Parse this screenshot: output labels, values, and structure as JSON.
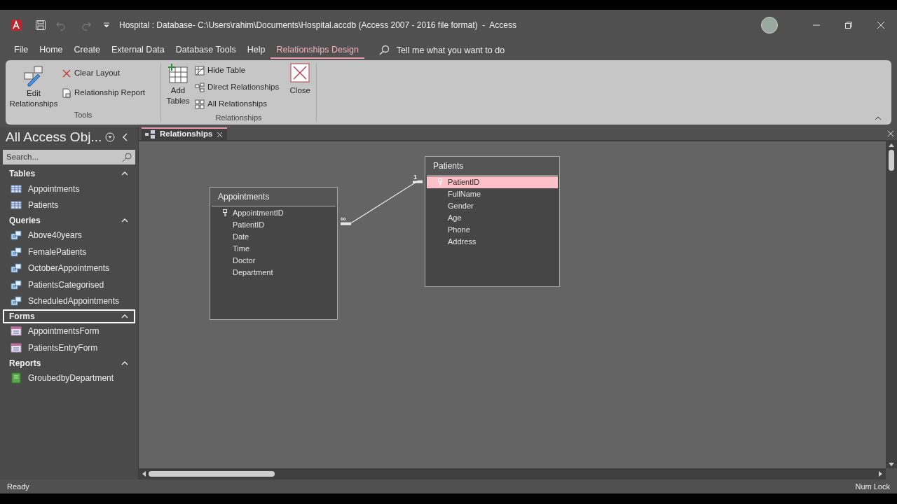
{
  "window": {
    "title": "Hospital : Database- C:\\Users\\rahim\\Documents\\Hospital.accdb (Access 2007 - 2016 file format)  -  Access"
  },
  "menu_tabs": [
    {
      "label": "File",
      "selected": false
    },
    {
      "label": "Home",
      "selected": false
    },
    {
      "label": "Create",
      "selected": false
    },
    {
      "label": "External Data",
      "selected": false
    },
    {
      "label": "Database Tools",
      "selected": false
    },
    {
      "label": "Help",
      "selected": false
    },
    {
      "label": "Relationships Design",
      "selected": true
    }
  ],
  "tell_me": {
    "placeholder": "Tell me what you want to do"
  },
  "ribbon": {
    "tools": {
      "label": "Tools",
      "edit_relationships": "Edit Relationships",
      "clear_layout": "Clear Layout",
      "relationship_report": "Relationship Report"
    },
    "relationships": {
      "label": "Relationships",
      "add_tables": "Add Tables",
      "hide_table": "Hide Table",
      "direct_relationships": "Direct Relationships",
      "all_relationships": "All Relationships",
      "close": "Close"
    }
  },
  "nav_pane": {
    "title": "All Access Obj...",
    "search": {
      "placeholder": "Search..."
    },
    "groups": [
      {
        "label": "Tables",
        "selected": false,
        "items": [
          {
            "label": "Appointments",
            "kind": "table"
          },
          {
            "label": "Patients",
            "kind": "table"
          }
        ]
      },
      {
        "label": "Queries",
        "selected": false,
        "items": [
          {
            "label": "Above40years",
            "kind": "query"
          },
          {
            "label": "FemalePatients",
            "kind": "query"
          },
          {
            "label": "OctoberAppointments",
            "kind": "query"
          },
          {
            "label": "PatientsCategorised",
            "kind": "query"
          },
          {
            "label": "ScheduledAppointments",
            "kind": "query"
          }
        ]
      },
      {
        "label": "Forms",
        "selected": true,
        "items": [
          {
            "label": "AppointmentsForm",
            "kind": "form"
          },
          {
            "label": "PatientsEntryForm",
            "kind": "form"
          }
        ]
      },
      {
        "label": "Reports",
        "selected": false,
        "items": [
          {
            "label": "GroubedbyDepartment",
            "kind": "report"
          }
        ]
      }
    ]
  },
  "document_tabs": [
    {
      "label": "Relationships",
      "selected": true
    }
  ],
  "tables": [
    {
      "name": "Appointments",
      "fields": [
        {
          "name": "AppointmentID",
          "key": true,
          "selected": false
        },
        {
          "name": "PatientID",
          "key": false,
          "selected": false
        },
        {
          "name": "Date",
          "key": false,
          "selected": false
        },
        {
          "name": "Time",
          "key": false,
          "selected": false
        },
        {
          "name": "Doctor",
          "key": false,
          "selected": false
        },
        {
          "name": "Department",
          "key": false,
          "selected": false
        }
      ]
    },
    {
      "name": "Patients",
      "fields": [
        {
          "name": "PatientID",
          "key": true,
          "selected": true
        },
        {
          "name": "FullName",
          "key": false,
          "selected": false
        },
        {
          "name": "Gender",
          "key": false,
          "selected": false
        },
        {
          "name": "Age",
          "key": false,
          "selected": false
        },
        {
          "name": "Phone",
          "key": false,
          "selected": false
        },
        {
          "name": "Address",
          "key": false,
          "selected": false
        }
      ]
    }
  ],
  "relationship": {
    "one_label": "1",
    "many_label": "∞"
  },
  "status_bar": {
    "left": "Ready",
    "right": "Num Lock"
  }
}
